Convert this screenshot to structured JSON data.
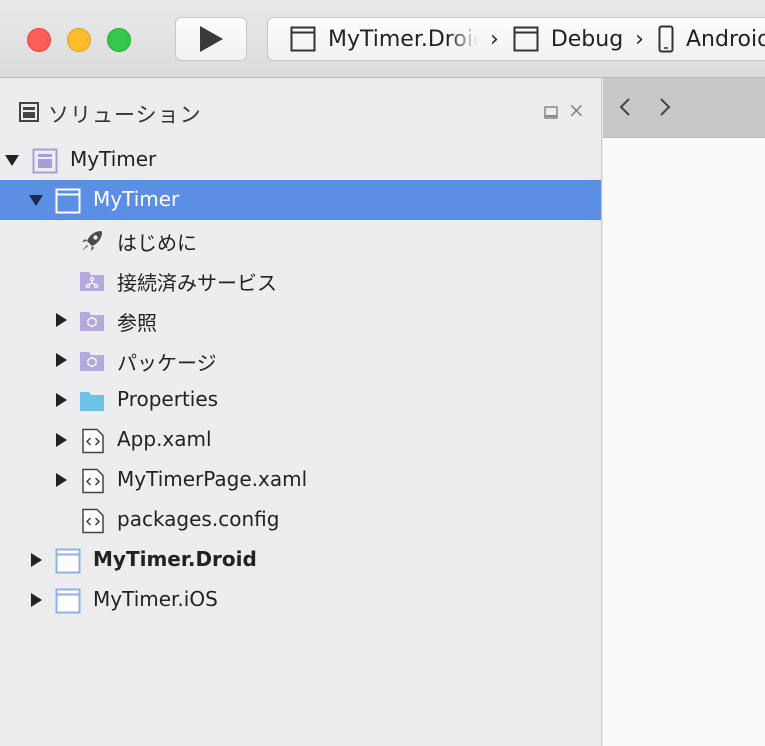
{
  "window": {
    "controls": {
      "close": "close-button",
      "minimize": "minimize-button",
      "maximize": "maximize-button"
    },
    "colors": {
      "close": "#fc5d57",
      "minimize": "#fdbc2e",
      "maximize": "#34c84a"
    }
  },
  "toolbar": {
    "run_icon": "play-icon",
    "config": {
      "project": "MyTimer.Droid",
      "configuration": "Debug",
      "device": "Android",
      "separator": "›"
    }
  },
  "solution_pad": {
    "title": "ソリューション",
    "icons": {
      "pad": "pad-icon",
      "minimize": "minimize-pad-icon",
      "close": "close-icon"
    },
    "close_glyph": "×",
    "selected_color": "#5b8fe3",
    "tree": [
      {
        "label": "MyTimer",
        "icon": "solution-icon",
        "expanded": true,
        "bold": false
      },
      {
        "label": "MyTimer",
        "icon": "project-icon",
        "expanded": true,
        "selected": true
      },
      {
        "label": "はじめに",
        "icon": "rocket-icon"
      },
      {
        "label": "接続済みサービス",
        "icon": "connected-services-folder-icon"
      },
      {
        "label": "参照",
        "icon": "references-folder-icon",
        "expanded": false
      },
      {
        "label": "パッケージ",
        "icon": "packages-folder-icon",
        "expanded": false
      },
      {
        "label": "Properties",
        "icon": "folder-icon",
        "expanded": false
      },
      {
        "label": "App.xaml",
        "icon": "xaml-file-icon",
        "expanded": false
      },
      {
        "label": "MyTimerPage.xaml",
        "icon": "xaml-file-icon",
        "expanded": false
      },
      {
        "label": "packages.config",
        "icon": "config-file-icon"
      },
      {
        "label": "MyTimer.Droid",
        "icon": "project-icon",
        "expanded": false,
        "bold": true
      },
      {
        "label": "MyTimer.iOS",
        "icon": "project-icon",
        "expanded": false
      }
    ]
  },
  "editor": {
    "nav": {
      "back": "‹",
      "forward": "›"
    }
  }
}
